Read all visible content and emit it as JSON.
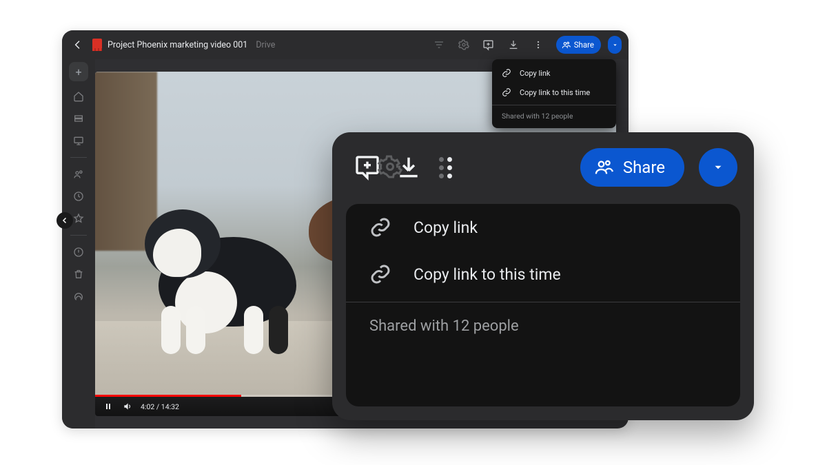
{
  "header": {
    "title": "Project Phoenix marketing video 001",
    "suffix": "Drive",
    "share_label": "Share"
  },
  "player": {
    "time_current": "4:02",
    "time_total": "14:32"
  },
  "share_menu": {
    "copy_link": "Copy link",
    "copy_link_time": "Copy link to this time",
    "shared_with": "Shared with 12 people"
  },
  "zoom": {
    "share_label": "Share",
    "copy_link": "Copy link",
    "copy_link_time": "Copy link to this time",
    "shared_with": "Shared with 12 people"
  }
}
